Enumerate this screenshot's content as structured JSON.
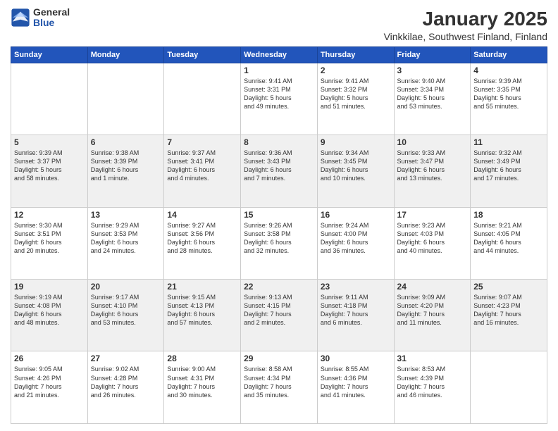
{
  "header": {
    "logo_general": "General",
    "logo_blue": "Blue",
    "title": "January 2025",
    "subtitle": "Vinkkilae, Southwest Finland, Finland"
  },
  "days_of_week": [
    "Sunday",
    "Monday",
    "Tuesday",
    "Wednesday",
    "Thursday",
    "Friday",
    "Saturday"
  ],
  "weeks": [
    [
      {
        "day": "",
        "info": ""
      },
      {
        "day": "",
        "info": ""
      },
      {
        "day": "",
        "info": ""
      },
      {
        "day": "1",
        "info": "Sunrise: 9:41 AM\nSunset: 3:31 PM\nDaylight: 5 hours\nand 49 minutes."
      },
      {
        "day": "2",
        "info": "Sunrise: 9:41 AM\nSunset: 3:32 PM\nDaylight: 5 hours\nand 51 minutes."
      },
      {
        "day": "3",
        "info": "Sunrise: 9:40 AM\nSunset: 3:34 PM\nDaylight: 5 hours\nand 53 minutes."
      },
      {
        "day": "4",
        "info": "Sunrise: 9:39 AM\nSunset: 3:35 PM\nDaylight: 5 hours\nand 55 minutes."
      }
    ],
    [
      {
        "day": "5",
        "info": "Sunrise: 9:39 AM\nSunset: 3:37 PM\nDaylight: 5 hours\nand 58 minutes."
      },
      {
        "day": "6",
        "info": "Sunrise: 9:38 AM\nSunset: 3:39 PM\nDaylight: 6 hours\nand 1 minute."
      },
      {
        "day": "7",
        "info": "Sunrise: 9:37 AM\nSunset: 3:41 PM\nDaylight: 6 hours\nand 4 minutes."
      },
      {
        "day": "8",
        "info": "Sunrise: 9:36 AM\nSunset: 3:43 PM\nDaylight: 6 hours\nand 7 minutes."
      },
      {
        "day": "9",
        "info": "Sunrise: 9:34 AM\nSunset: 3:45 PM\nDaylight: 6 hours\nand 10 minutes."
      },
      {
        "day": "10",
        "info": "Sunrise: 9:33 AM\nSunset: 3:47 PM\nDaylight: 6 hours\nand 13 minutes."
      },
      {
        "day": "11",
        "info": "Sunrise: 9:32 AM\nSunset: 3:49 PM\nDaylight: 6 hours\nand 17 minutes."
      }
    ],
    [
      {
        "day": "12",
        "info": "Sunrise: 9:30 AM\nSunset: 3:51 PM\nDaylight: 6 hours\nand 20 minutes."
      },
      {
        "day": "13",
        "info": "Sunrise: 9:29 AM\nSunset: 3:53 PM\nDaylight: 6 hours\nand 24 minutes."
      },
      {
        "day": "14",
        "info": "Sunrise: 9:27 AM\nSunset: 3:56 PM\nDaylight: 6 hours\nand 28 minutes."
      },
      {
        "day": "15",
        "info": "Sunrise: 9:26 AM\nSunset: 3:58 PM\nDaylight: 6 hours\nand 32 minutes."
      },
      {
        "day": "16",
        "info": "Sunrise: 9:24 AM\nSunset: 4:00 PM\nDaylight: 6 hours\nand 36 minutes."
      },
      {
        "day": "17",
        "info": "Sunrise: 9:23 AM\nSunset: 4:03 PM\nDaylight: 6 hours\nand 40 minutes."
      },
      {
        "day": "18",
        "info": "Sunrise: 9:21 AM\nSunset: 4:05 PM\nDaylight: 6 hours\nand 44 minutes."
      }
    ],
    [
      {
        "day": "19",
        "info": "Sunrise: 9:19 AM\nSunset: 4:08 PM\nDaylight: 6 hours\nand 48 minutes."
      },
      {
        "day": "20",
        "info": "Sunrise: 9:17 AM\nSunset: 4:10 PM\nDaylight: 6 hours\nand 53 minutes."
      },
      {
        "day": "21",
        "info": "Sunrise: 9:15 AM\nSunset: 4:13 PM\nDaylight: 6 hours\nand 57 minutes."
      },
      {
        "day": "22",
        "info": "Sunrise: 9:13 AM\nSunset: 4:15 PM\nDaylight: 7 hours\nand 2 minutes."
      },
      {
        "day": "23",
        "info": "Sunrise: 9:11 AM\nSunset: 4:18 PM\nDaylight: 7 hours\nand 6 minutes."
      },
      {
        "day": "24",
        "info": "Sunrise: 9:09 AM\nSunset: 4:20 PM\nDaylight: 7 hours\nand 11 minutes."
      },
      {
        "day": "25",
        "info": "Sunrise: 9:07 AM\nSunset: 4:23 PM\nDaylight: 7 hours\nand 16 minutes."
      }
    ],
    [
      {
        "day": "26",
        "info": "Sunrise: 9:05 AM\nSunset: 4:26 PM\nDaylight: 7 hours\nand 21 minutes."
      },
      {
        "day": "27",
        "info": "Sunrise: 9:02 AM\nSunset: 4:28 PM\nDaylight: 7 hours\nand 26 minutes."
      },
      {
        "day": "28",
        "info": "Sunrise: 9:00 AM\nSunset: 4:31 PM\nDaylight: 7 hours\nand 30 minutes."
      },
      {
        "day": "29",
        "info": "Sunrise: 8:58 AM\nSunset: 4:34 PM\nDaylight: 7 hours\nand 35 minutes."
      },
      {
        "day": "30",
        "info": "Sunrise: 8:55 AM\nSunset: 4:36 PM\nDaylight: 7 hours\nand 41 minutes."
      },
      {
        "day": "31",
        "info": "Sunrise: 8:53 AM\nSunset: 4:39 PM\nDaylight: 7 hours\nand 46 minutes."
      },
      {
        "day": "",
        "info": ""
      }
    ]
  ]
}
